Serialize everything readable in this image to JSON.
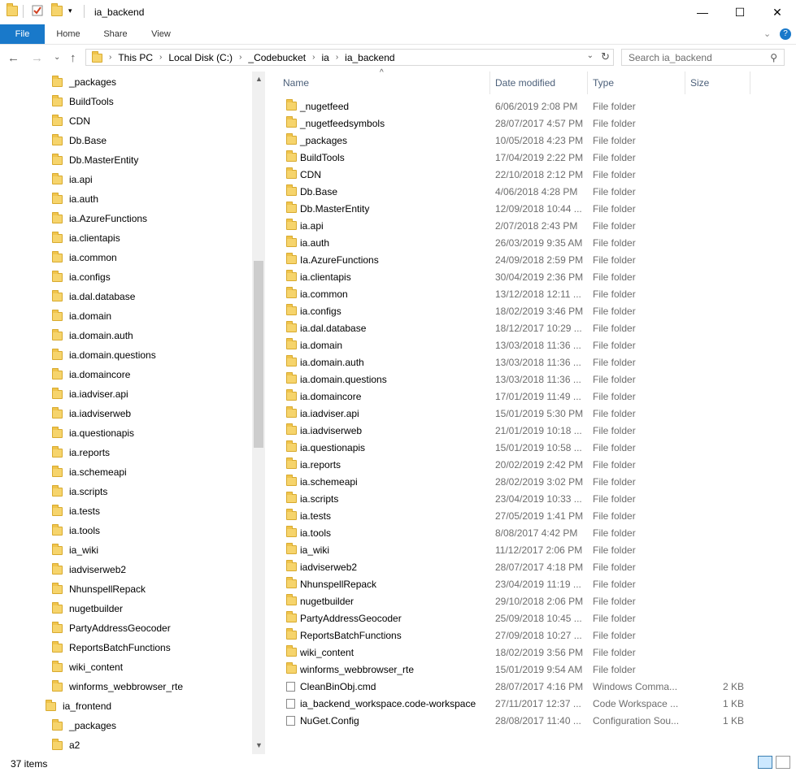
{
  "window": {
    "title": "ia_backend"
  },
  "ribbon": {
    "tabs": [
      "File",
      "Home",
      "Share",
      "View"
    ]
  },
  "address": {
    "crumbs": [
      "This PC",
      "Local Disk (C:)",
      "_Codebucket",
      "ia",
      "ia_backend"
    ]
  },
  "search": {
    "placeholder": "Search ia_backend"
  },
  "columns": {
    "name": "Name",
    "date": "Date modified",
    "type": "Type",
    "size": "Size"
  },
  "nav": [
    {
      "label": "_packages"
    },
    {
      "label": "BuildTools"
    },
    {
      "label": "CDN"
    },
    {
      "label": "Db.Base"
    },
    {
      "label": "Db.MasterEntity"
    },
    {
      "label": "ia.api"
    },
    {
      "label": "ia.auth"
    },
    {
      "label": "ia.AzureFunctions"
    },
    {
      "label": "ia.clientapis"
    },
    {
      "label": "ia.common"
    },
    {
      "label": "ia.configs"
    },
    {
      "label": "ia.dal.database"
    },
    {
      "label": "ia.domain"
    },
    {
      "label": "ia.domain.auth"
    },
    {
      "label": "ia.domain.questions"
    },
    {
      "label": "ia.domaincore"
    },
    {
      "label": "ia.iadviser.api"
    },
    {
      "label": "ia.iadviserweb"
    },
    {
      "label": "ia.questionapis"
    },
    {
      "label": "ia.reports"
    },
    {
      "label": "ia.schemeapi"
    },
    {
      "label": "ia.scripts"
    },
    {
      "label": "ia.tests"
    },
    {
      "label": "ia.tools"
    },
    {
      "label": "ia_wiki"
    },
    {
      "label": "iadviserweb2"
    },
    {
      "label": "NhunspellRepack"
    },
    {
      "label": "nugetbuilder"
    },
    {
      "label": "PartyAddressGeocoder"
    },
    {
      "label": "ReportsBatchFunctions"
    },
    {
      "label": "wiki_content"
    },
    {
      "label": "winforms_webbrowser_rte"
    },
    {
      "label": "ia_frontend",
      "level": 0
    },
    {
      "label": "_packages"
    },
    {
      "label": "a2"
    }
  ],
  "files": [
    {
      "name": "_nugetfeed",
      "date": "6/06/2019 2:08 PM",
      "type": "File folder",
      "size": "",
      "icon": "folder"
    },
    {
      "name": "_nugetfeedsymbols",
      "date": "28/07/2017 4:57 PM",
      "type": "File folder",
      "size": "",
      "icon": "folder"
    },
    {
      "name": "_packages",
      "date": "10/05/2018 4:23 PM",
      "type": "File folder",
      "size": "",
      "icon": "folder"
    },
    {
      "name": "BuildTools",
      "date": "17/04/2019 2:22 PM",
      "type": "File folder",
      "size": "",
      "icon": "folder"
    },
    {
      "name": "CDN",
      "date": "22/10/2018 2:12 PM",
      "type": "File folder",
      "size": "",
      "icon": "folder"
    },
    {
      "name": "Db.Base",
      "date": "4/06/2018 4:28 PM",
      "type": "File folder",
      "size": "",
      "icon": "folder"
    },
    {
      "name": "Db.MasterEntity",
      "date": "12/09/2018 10:44 ...",
      "type": "File folder",
      "size": "",
      "icon": "folder"
    },
    {
      "name": "ia.api",
      "date": "2/07/2018 2:43 PM",
      "type": "File folder",
      "size": "",
      "icon": "folder"
    },
    {
      "name": "ia.auth",
      "date": "26/03/2019 9:35 AM",
      "type": "File folder",
      "size": "",
      "icon": "folder"
    },
    {
      "name": "Ia.AzureFunctions",
      "date": "24/09/2018 2:59 PM",
      "type": "File folder",
      "size": "",
      "icon": "folder"
    },
    {
      "name": "ia.clientapis",
      "date": "30/04/2019 2:36 PM",
      "type": "File folder",
      "size": "",
      "icon": "folder"
    },
    {
      "name": "ia.common",
      "date": "13/12/2018 12:11 ...",
      "type": "File folder",
      "size": "",
      "icon": "folder"
    },
    {
      "name": "ia.configs",
      "date": "18/02/2019 3:46 PM",
      "type": "File folder",
      "size": "",
      "icon": "folder"
    },
    {
      "name": "ia.dal.database",
      "date": "18/12/2017 10:29 ...",
      "type": "File folder",
      "size": "",
      "icon": "folder"
    },
    {
      "name": "ia.domain",
      "date": "13/03/2018 11:36 ...",
      "type": "File folder",
      "size": "",
      "icon": "folder"
    },
    {
      "name": "ia.domain.auth",
      "date": "13/03/2018 11:36 ...",
      "type": "File folder",
      "size": "",
      "icon": "folder"
    },
    {
      "name": "ia.domain.questions",
      "date": "13/03/2018 11:36 ...",
      "type": "File folder",
      "size": "",
      "icon": "folder"
    },
    {
      "name": "ia.domaincore",
      "date": "17/01/2019 11:49 ...",
      "type": "File folder",
      "size": "",
      "icon": "folder"
    },
    {
      "name": "ia.iadviser.api",
      "date": "15/01/2019 5:30 PM",
      "type": "File folder",
      "size": "",
      "icon": "folder"
    },
    {
      "name": "ia.iadviserweb",
      "date": "21/01/2019 10:18 ...",
      "type": "File folder",
      "size": "",
      "icon": "folder"
    },
    {
      "name": "ia.questionapis",
      "date": "15/01/2019 10:58 ...",
      "type": "File folder",
      "size": "",
      "icon": "folder"
    },
    {
      "name": "ia.reports",
      "date": "20/02/2019 2:42 PM",
      "type": "File folder",
      "size": "",
      "icon": "folder"
    },
    {
      "name": "ia.schemeapi",
      "date": "28/02/2019 3:02 PM",
      "type": "File folder",
      "size": "",
      "icon": "folder"
    },
    {
      "name": "ia.scripts",
      "date": "23/04/2019 10:33 ...",
      "type": "File folder",
      "size": "",
      "icon": "folder"
    },
    {
      "name": "ia.tests",
      "date": "27/05/2019 1:41 PM",
      "type": "File folder",
      "size": "",
      "icon": "folder"
    },
    {
      "name": "ia.tools",
      "date": "8/08/2017 4:42 PM",
      "type": "File folder",
      "size": "",
      "icon": "folder"
    },
    {
      "name": "ia_wiki",
      "date": "11/12/2017 2:06 PM",
      "type": "File folder",
      "size": "",
      "icon": "folder"
    },
    {
      "name": "iadviserweb2",
      "date": "28/07/2017 4:18 PM",
      "type": "File folder",
      "size": "",
      "icon": "folder"
    },
    {
      "name": "NhunspellRepack",
      "date": "23/04/2019 11:19 ...",
      "type": "File folder",
      "size": "",
      "icon": "folder"
    },
    {
      "name": "nugetbuilder",
      "date": "29/10/2018 2:06 PM",
      "type": "File folder",
      "size": "",
      "icon": "folder"
    },
    {
      "name": "PartyAddressGeocoder",
      "date": "25/09/2018 10:45 ...",
      "type": "File folder",
      "size": "",
      "icon": "folder"
    },
    {
      "name": "ReportsBatchFunctions",
      "date": "27/09/2018 10:27 ...",
      "type": "File folder",
      "size": "",
      "icon": "folder"
    },
    {
      "name": "wiki_content",
      "date": "18/02/2019 3:56 PM",
      "type": "File folder",
      "size": "",
      "icon": "folder"
    },
    {
      "name": "winforms_webbrowser_rte",
      "date": "15/01/2019 9:54 AM",
      "type": "File folder",
      "size": "",
      "icon": "folder"
    },
    {
      "name": "CleanBinObj.cmd",
      "date": "28/07/2017 4:16 PM",
      "type": "Windows Comma...",
      "size": "2 KB",
      "icon": "file"
    },
    {
      "name": "ia_backend_workspace.code-workspace",
      "date": "27/11/2017 12:37 ...",
      "type": "Code Workspace ...",
      "size": "1 KB",
      "icon": "file"
    },
    {
      "name": "NuGet.Config",
      "date": "28/08/2017 11:40 ...",
      "type": "Configuration Sou...",
      "size": "1 KB",
      "icon": "file"
    }
  ],
  "status": {
    "count": "37 items"
  }
}
